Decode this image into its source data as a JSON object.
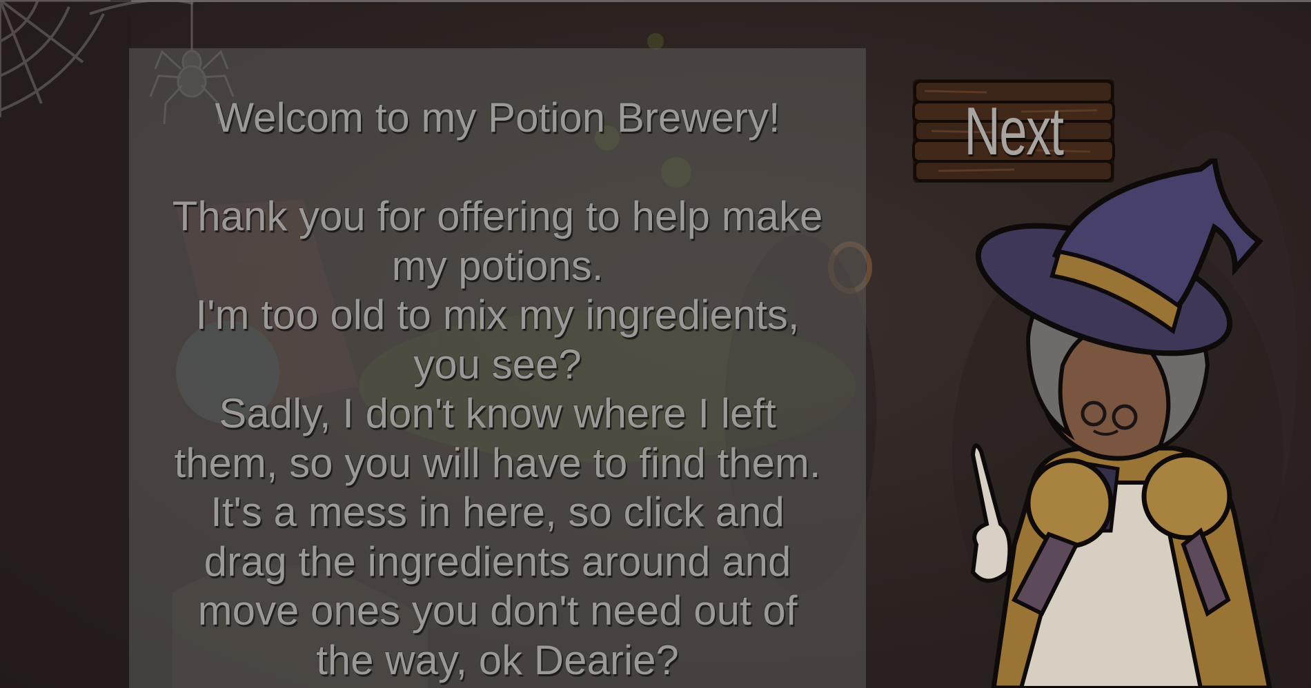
{
  "dialog": {
    "title": "Welcom to my Potion Brewery!",
    "lines": [
      "Thank you for offering to help make",
      "my potions.",
      "I'm too old to mix my ingredients,",
      "you see?",
      "Sadly, I don't know where I left",
      "them, so you will have to find them.",
      "It's a mess in here, so click and",
      "drag the ingredients around and",
      "move ones you don't need out of",
      "the way, ok Dearie?"
    ]
  },
  "next_button": {
    "label": "Next"
  },
  "colors": {
    "background": "#2c2321",
    "panel": "#5f5c5a",
    "text": "#9b9896",
    "wood": "#3b2418",
    "witch_hat": "#3e3757",
    "hat_band": "#9a7435",
    "witch_skin": "#7a5540",
    "witch_hair": "#6e6c6a"
  },
  "icons": [
    "spider-web-icon",
    "spider-icon",
    "cauldron-icon",
    "wooden-sign-icon",
    "witch-character"
  ]
}
